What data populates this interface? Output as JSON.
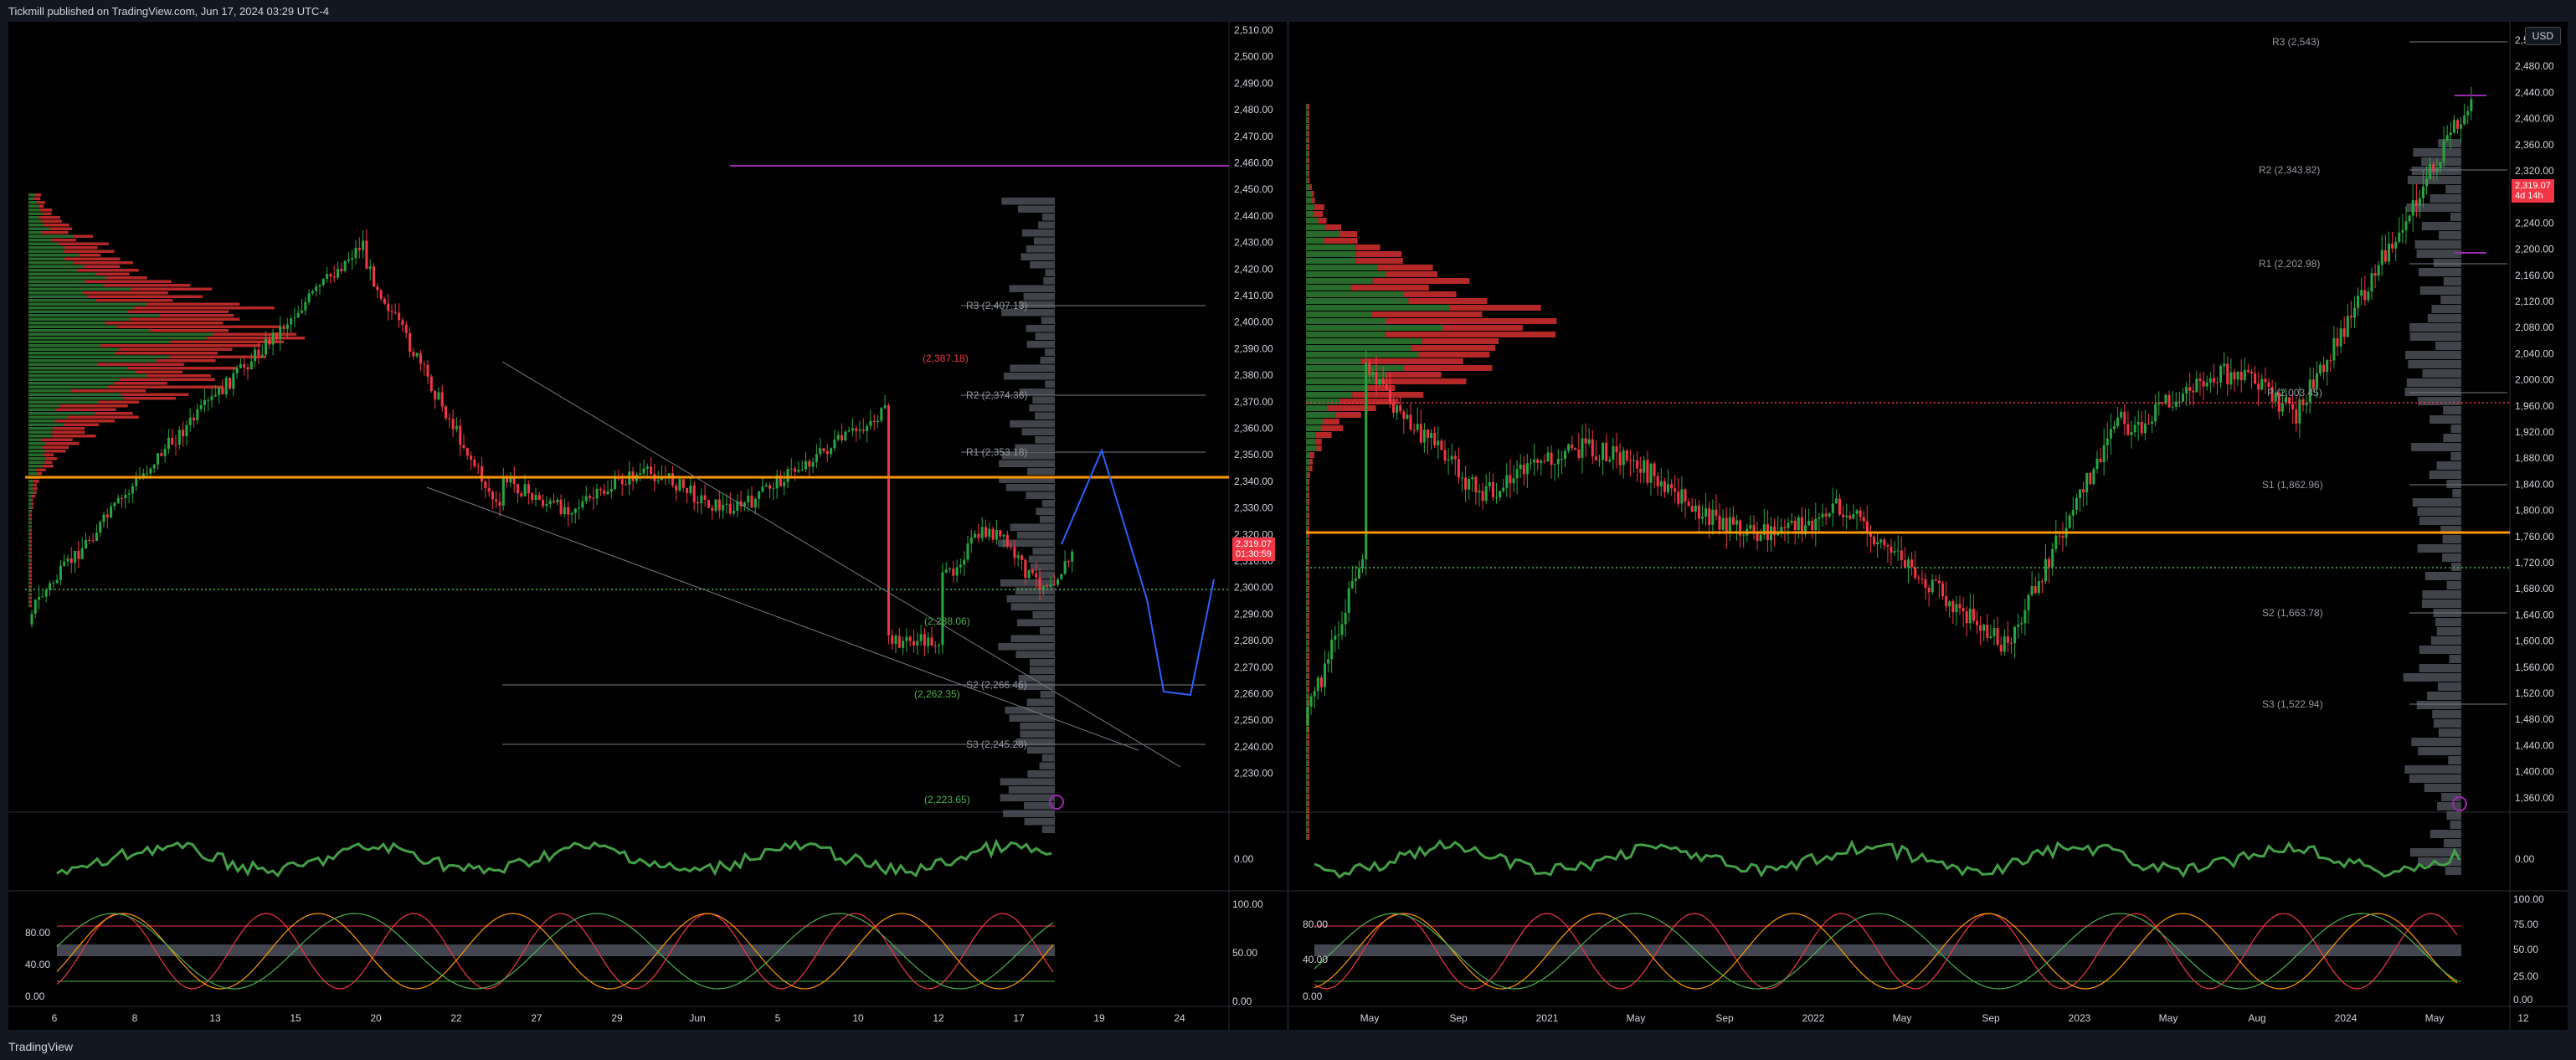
{
  "header": {
    "publisher": "Tickmill published on TradingView.com, Jun 17, 2024 03:29 UTC-4"
  },
  "footer": {
    "brand": "TradingView"
  },
  "colors": {
    "up": "#26a69a",
    "green": "#4caf50",
    "red": "#f23645",
    "orange": "#ff9800",
    "purple": "#9c27b0",
    "blue": "#2962ff"
  },
  "left_chart": {
    "price_labels": [
      "2,510.00",
      "2,500.00",
      "2,490.00",
      "2,480.00",
      "2,470.00",
      "2,460.00",
      "2,450.00",
      "2,440.00",
      "2,430.00",
      "2,420.00",
      "2,410.00",
      "2,400.00",
      "2,390.00",
      "2,380.00",
      "2,370.00",
      "2,360.00",
      "2,350.00",
      "2,340.00",
      "2,330.00",
      "2,320.00",
      "2,310.00",
      "2,300.00",
      "2,290.00",
      "2,280.00",
      "2,270.00",
      "2,260.00",
      "2,250.00",
      "2,240.00",
      "2,230.00"
    ],
    "price_tag": {
      "price": "2,319.07",
      "timer": "01:30:59"
    },
    "pivot_labels": [
      "R3 (2,407.13)",
      "R2 (2,374.36)",
      "R1 (2,353.18)",
      "S2 (2,266.46)",
      "S3 (2,245.28)"
    ],
    "extra_labels": [
      "(2,387.18)",
      "(2,262.35)",
      "(2,223.65)",
      "(2,288.06)"
    ],
    "time_labels": [
      "6",
      "8",
      "13",
      "15",
      "20",
      "22",
      "27",
      "29",
      "Jun",
      "5",
      "10",
      "12",
      "17",
      "19",
      "24"
    ],
    "osc1_labels": [
      "0.00"
    ],
    "osc2_labels": [
      "80.00",
      "40.00",
      "0.00",
      "100.00",
      "50.00",
      "0.00"
    ]
  },
  "right_chart": {
    "currency": "USD",
    "price_labels": [
      "2,520.00",
      "2,480.00",
      "2,440.00",
      "2,400.00",
      "2,360.00",
      "2,320.00",
      "2,280.00",
      "2,240.00",
      "2,200.00",
      "2,160.00",
      "2,120.00",
      "2,080.00",
      "2,040.00",
      "2,000.00",
      "1,960.00",
      "1,920.00",
      "1,880.00",
      "1,840.00",
      "1,800.00",
      "1,760.00",
      "1,720.00",
      "1,680.00",
      "1,640.00",
      "1,600.00",
      "1,560.00",
      "1,520.00",
      "1,480.00",
      "1,440.00",
      "1,400.00",
      "1,360.00"
    ],
    "price_tag": {
      "price": "2,319.07",
      "timer": "4d 14h"
    },
    "pivot_labels": [
      "R3 (2,543)",
      "R2 (2,343.82)",
      "R1 (2,202.98)",
      "P (2,003.45)",
      "S1 (1,862.96)",
      "S2 (1,663.78)",
      "S3 (1,522.94)"
    ],
    "time_labels": [
      "May",
      "Sep",
      "2021",
      "May",
      "Sep",
      "2022",
      "May",
      "Sep",
      "2023",
      "May",
      "Aug",
      "2024",
      "May",
      "12"
    ],
    "osc1_labels": [
      "0.00"
    ],
    "osc2_labels": [
      "80.00",
      "40.00",
      "0.00",
      "100.00",
      "75.00",
      "50.00",
      "25.00",
      "0.00"
    ]
  }
}
